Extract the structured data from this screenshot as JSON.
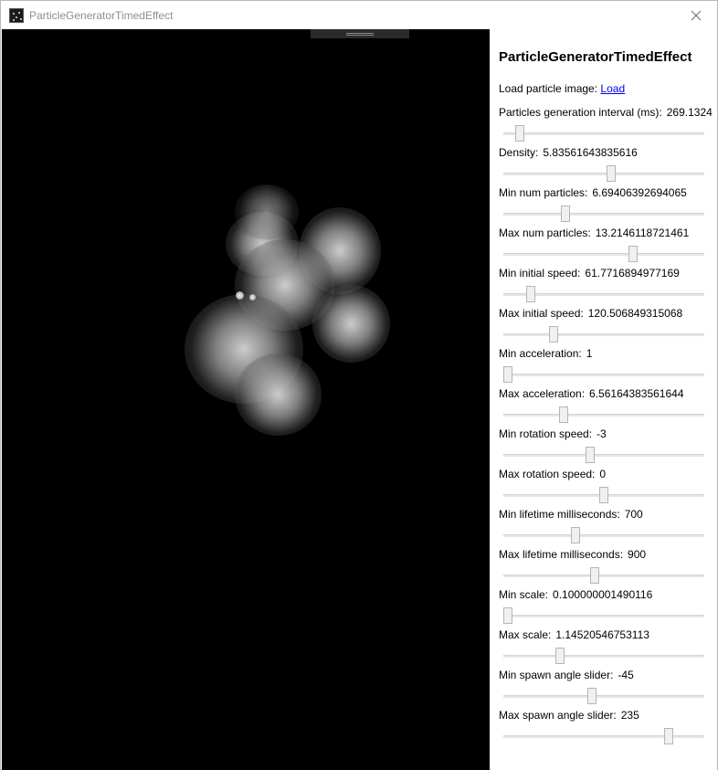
{
  "window": {
    "title": "ParticleGeneratorTimedEffect"
  },
  "panel": {
    "title": "ParticleGeneratorTimedEffect",
    "load_label": "Load particle image:",
    "load_link": "Load",
    "params": [
      {
        "label": "Particles generation interval (ms):",
        "value": "269.1324",
        "fraction": 0.06
      },
      {
        "label": "Density:",
        "value": "5.83561643835616",
        "fraction": 0.54
      },
      {
        "label": "Min num particles:",
        "value": "6.69406392694065",
        "fraction": 0.3
      },
      {
        "label": "Max num particles:",
        "value": "13.2146118721461",
        "fraction": 0.65
      },
      {
        "label": "Min initial speed:",
        "value": "61.7716894977169",
        "fraction": 0.12
      },
      {
        "label": "Max initial speed:",
        "value": "120.506849315068",
        "fraction": 0.24
      },
      {
        "label": "Min acceleration:",
        "value": "1",
        "fraction": 0.0
      },
      {
        "label": "Max acceleration:",
        "value": "6.56164383561644",
        "fraction": 0.29
      },
      {
        "label": "Min rotation speed:",
        "value": "-3",
        "fraction": 0.43
      },
      {
        "label": "Max rotation speed:",
        "value": "0",
        "fraction": 0.5
      },
      {
        "label": "Min lifetime milliseconds:",
        "value": "700",
        "fraction": 0.35
      },
      {
        "label": "Max lifetime milliseconds:",
        "value": "900",
        "fraction": 0.45
      },
      {
        "label": "Min scale:",
        "value": "0.100000001490116",
        "fraction": 0.0
      },
      {
        "label": "Max scale:",
        "value": "1.14520546753113",
        "fraction": 0.27
      },
      {
        "label": "Min spawn angle slider:",
        "value": "-45",
        "fraction": 0.44
      },
      {
        "label": "Max spawn angle slider:",
        "value": "235",
        "fraction": 0.84
      }
    ]
  },
  "colors": {
    "canvas_background": "#000000",
    "link": "#0000ee",
    "title_text": "#8e8e8e"
  },
  "icons": {
    "app": "particle-app-icon",
    "close": "close-icon",
    "grip": "drag-grip-icon"
  }
}
